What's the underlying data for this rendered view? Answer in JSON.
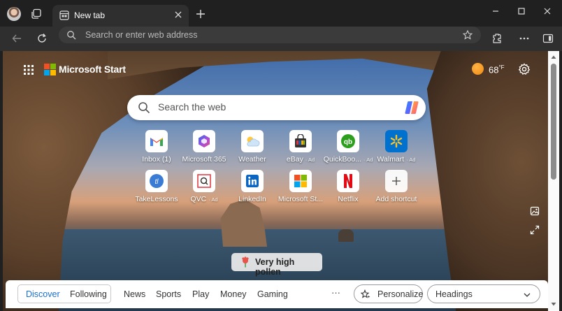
{
  "tab": {
    "title": "New tab"
  },
  "address_bar": {
    "placeholder": "Search or enter web address"
  },
  "header": {
    "brand": "Microsoft Start",
    "temperature": "68",
    "unit": "°F"
  },
  "search": {
    "placeholder": "Search the web"
  },
  "shortcuts": [
    {
      "label": "Inbox (1)",
      "ad": "",
      "icon": "gmail-icon"
    },
    {
      "label": "Microsoft 365",
      "ad": "",
      "icon": "microsoft-365-icon"
    },
    {
      "label": "Weather",
      "ad": "",
      "icon": "weather-icon"
    },
    {
      "label": "eBay",
      "ad": "· Ad",
      "icon": "ebay-icon"
    },
    {
      "label": "QuickBoo...",
      "ad": "· Ad",
      "icon": "quickbooks-icon"
    },
    {
      "label": "Walmart",
      "ad": "· Ad",
      "icon": "walmart-icon"
    },
    {
      "label": "TakeLessons",
      "ad": "",
      "icon": "takelessons-icon"
    },
    {
      "label": "QVC",
      "ad": "· Ad",
      "icon": "qvc-icon"
    },
    {
      "label": "LinkedIn",
      "ad": "",
      "icon": "linkedin-icon"
    },
    {
      "label": "Microsoft St...",
      "ad": "",
      "icon": "microsoft-store-icon"
    },
    {
      "label": "Netflix",
      "ad": "",
      "icon": "netflix-icon"
    },
    {
      "label": "Add shortcut",
      "ad": "",
      "icon": "plus-icon"
    }
  ],
  "pollen": {
    "label": "Very high pollen"
  },
  "feed_nav": {
    "segments": [
      "Discover",
      "Following"
    ],
    "links": [
      "News",
      "Sports",
      "Play",
      "Money",
      "Gaming"
    ],
    "more": "···",
    "personalize": "Personalize",
    "headings": "Headings"
  },
  "colors": {
    "accent": "#1a6fd1",
    "chrome": "#202020",
    "toolbar": "#2f2f2f"
  }
}
